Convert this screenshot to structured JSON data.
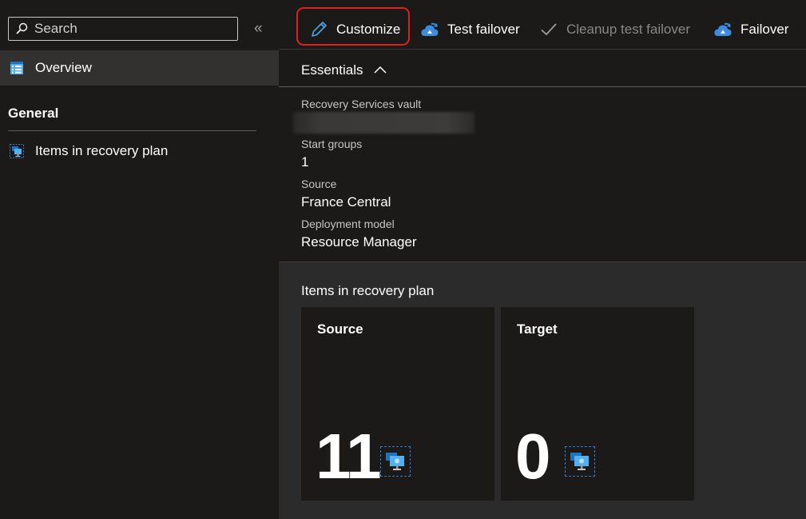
{
  "search": {
    "placeholder": "Search"
  },
  "sidebar": {
    "collapse_glyph": "«",
    "overview_label": "Overview",
    "section_general": "General",
    "items_label": "Items in recovery plan"
  },
  "toolbar": {
    "customize": "Customize",
    "test_failover": "Test failover",
    "cleanup_test_failover": "Cleanup test failover",
    "failover": "Failover"
  },
  "essentials": {
    "label": "Essentials",
    "props": {
      "vault_label": "Recovery Services vault",
      "start_groups_label": "Start groups",
      "start_groups_value": "1",
      "source_label": "Source",
      "source_value": "France Central",
      "deployment_label": "Deployment model",
      "deployment_value": "Resource Manager"
    }
  },
  "items_section": {
    "title": "Items in recovery plan",
    "source": {
      "title": "Source",
      "count": "11"
    },
    "target": {
      "title": "Target",
      "count": "0"
    }
  },
  "colors": {
    "accent": "#2f7fd1",
    "highlight": "#e0201c",
    "background": "#1b1a19",
    "panel": "#2b2b2b"
  },
  "icons": [
    "search-icon",
    "collapse-icon",
    "overview-icon",
    "vm-items-icon",
    "pencil-icon",
    "cloud-test-icon",
    "check-icon",
    "cloud-failover-icon",
    "chevron-up-icon",
    "vm-icon"
  ]
}
